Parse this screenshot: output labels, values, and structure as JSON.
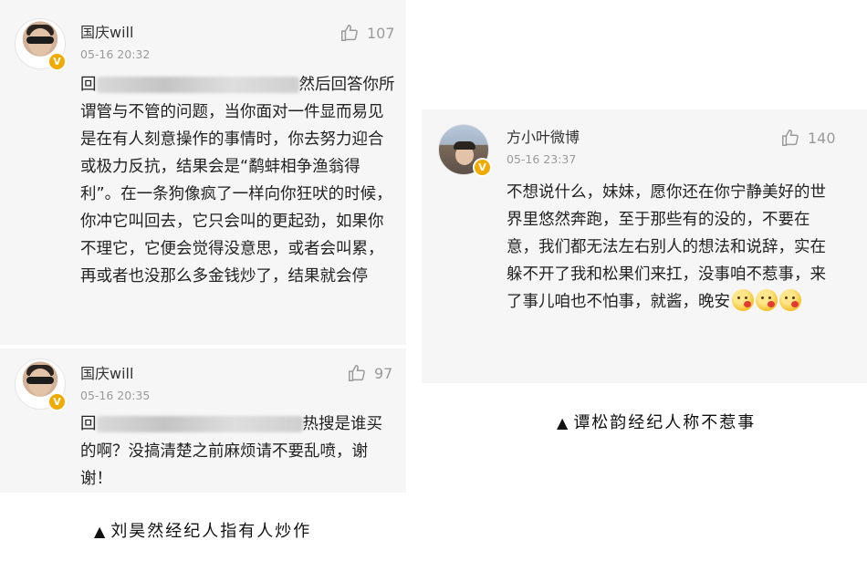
{
  "comments": [
    {
      "username": "国庆will",
      "timestamp": "05-16 20:32",
      "likes": "107",
      "content_lead": "回",
      "content_main": "然后回答你所谓管与不管的问题，当你面对一件显而易见是在有人刻意操作的事情时，你去努力迎合或极力反抗，结果会是“鹬蚌相争渔翁得利”。在一条狗像疯了一样向你狂吠的时候，你冲它叫回去，它只会叫的更起劲，如果你不理它，它便会觉得没意思，或者会叫累，再或者也没那么多金钱炒了，结果就会停"
    },
    {
      "username": "国庆will",
      "timestamp": "05-16 20:35",
      "likes": "97",
      "content_lead": "回",
      "content_main": "热搜是谁买的啊？没搞清楚之前麻烦请不要乱喷，谢谢！"
    },
    {
      "username": "方小叶微博",
      "timestamp": "05-16 23:37",
      "likes": "140",
      "content_main": "不想说什么，妹妹，愿你还在你宁静美好的世界里悠然奔跑，至于那些有的没的，不要在意，我们都无法左右别人的想法和说辞，实在躲不开了我和松果们来扛，没事咱不惹事，来了事儿咱也不怕事，就酱，晚安"
    }
  ],
  "captions": {
    "left": "刘昊然经纪人指有人炒作",
    "right": "谭松韵经纪人称不惹事",
    "marker": "▲"
  },
  "icons": {
    "like": "thumbs-up-icon",
    "verified": "verified-badge-icon",
    "emoji": "blushing-kiss-emoji"
  },
  "colors": {
    "panel": "#f6f6f6",
    "badge": "#f2a900",
    "muted": "#9a9a9a"
  }
}
